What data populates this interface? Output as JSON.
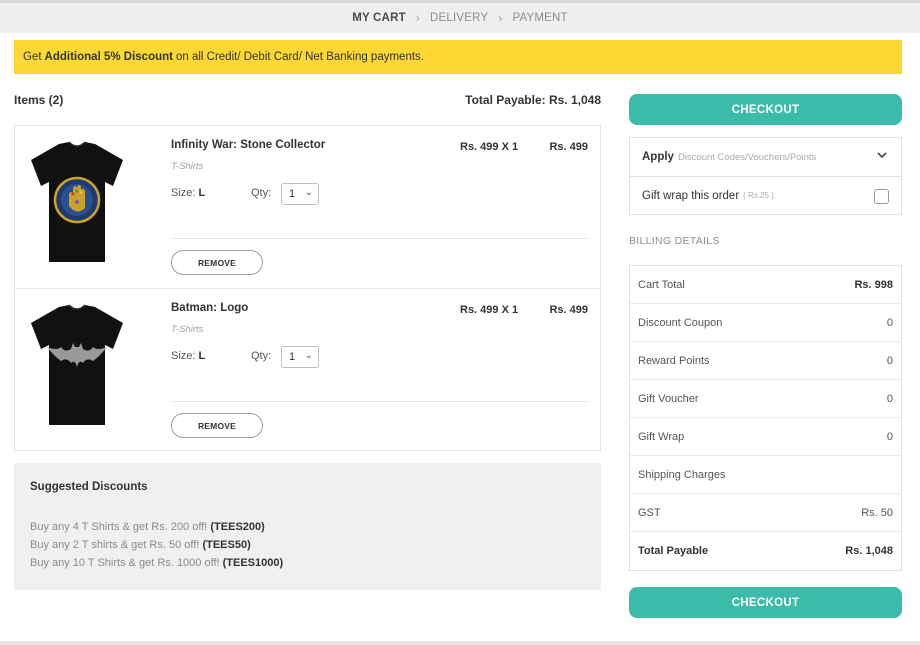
{
  "steps": [
    "MY CART",
    "DELIVERY",
    "PAYMENT"
  ],
  "promo": {
    "prefix": "Get",
    "highlight": "Additional 5% Discount",
    "suffix": "on all Credit/ Debit Card/ Net Banking payments."
  },
  "cart": {
    "items_label": "Items (2)",
    "total_payable_label": "Total Payable: Rs. 1,048",
    "size_label": "Size:",
    "qty_label": "Qty:",
    "remove_label": "REMOVE",
    "items": [
      {
        "name": "Infinity War: Stone Collector",
        "category": "T-Shirts",
        "size": "L",
        "qty": "1",
        "unit_price": "Rs. 499 X 1",
        "line_total": "Rs. 499",
        "print_color": "#c9a227"
      },
      {
        "name": "Batman: Logo",
        "category": "T-Shirts",
        "size": "L",
        "qty": "1",
        "unit_price": "Rs. 499 X 1",
        "line_total": "Rs. 499",
        "print_color": "#9a9a9a"
      }
    ]
  },
  "suggested": {
    "title": "Suggested Discounts",
    "offers": [
      {
        "text": "Buy any 4 T Shirts & get Rs. 200 off!",
        "code": "(TEES200)"
      },
      {
        "text": "Buy any 2 T shirts & get Rs. 50 off!",
        "code": "(TEES50)"
      },
      {
        "text": "Buy any 10 T Shirts & get Rs. 1000 off!",
        "code": "(TEES1000)"
      }
    ]
  },
  "sidebar": {
    "checkout_label": "CHECKOUT",
    "apply_label": "Apply",
    "apply_hint": "Discount Codes/Vouchers/Points",
    "gift_wrap_label": "Gift wrap this order",
    "gift_wrap_price": "( Rs.25 )",
    "billing_title": "BILLING DETAILS",
    "billing": [
      {
        "label": "Cart Total",
        "value": "Rs. 998"
      },
      {
        "label": "Discount Coupon",
        "value": "0"
      },
      {
        "label": "Reward Points",
        "value": "0"
      },
      {
        "label": "Gift Voucher",
        "value": "0"
      },
      {
        "label": "Gift Wrap",
        "value": "0"
      },
      {
        "label": "Shipping Charges",
        "value": ""
      },
      {
        "label": "GST",
        "value": "Rs. 50"
      },
      {
        "label": "Total Payable",
        "value": "Rs. 1,048"
      }
    ]
  },
  "colors": {
    "accent": "#3cbca8",
    "promo_bg": "#fdd835"
  }
}
